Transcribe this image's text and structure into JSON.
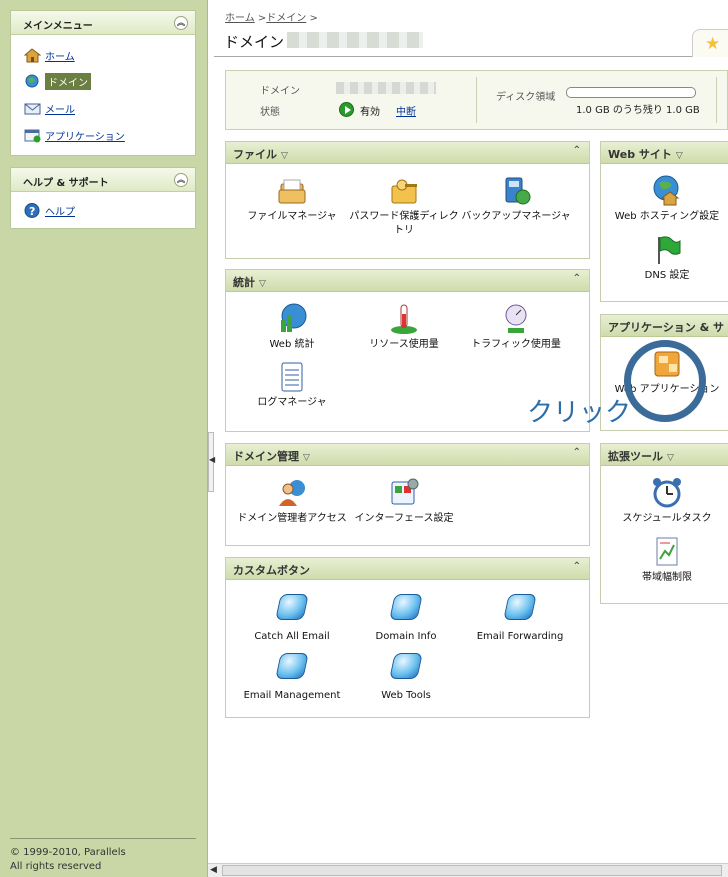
{
  "sidebar": {
    "main_menu": {
      "title": "メインメニュー",
      "items": [
        {
          "label": "ホーム",
          "icon": "home-icon"
        },
        {
          "label": "ドメイン",
          "icon": "domain-icon",
          "active": true
        },
        {
          "label": "メール",
          "icon": "mail-icon"
        },
        {
          "label": "アプリケーション",
          "icon": "application-icon"
        }
      ]
    },
    "help_menu": {
      "title": "ヘルプ & サポート",
      "items": [
        {
          "label": "ヘルプ",
          "icon": "help-icon"
        }
      ]
    },
    "copyright_line1": "© 1999-2010, Parallels",
    "copyright_line2": "All rights reserved"
  },
  "breadcrumb": {
    "home": "ホーム",
    "sep": ">",
    "domain": "ドメイン"
  },
  "page_title": "ドメイン",
  "info": {
    "domain_label": "ドメイン",
    "status_label": "状態",
    "status_value": "有効",
    "suspend_link": "中断",
    "disk_label": "ディスク領域",
    "disk_text": "1.0 GB のうち残り 1.0 GB",
    "disk_used_fraction": 0
  },
  "panels": {
    "files": {
      "title": "ファイル",
      "tools": [
        "ファイルマネージャ",
        "パスワード保護ディレクトリ",
        "バックアップマネージャ"
      ]
    },
    "stats": {
      "title": "統計",
      "tools": [
        "Web 統計",
        "リソース使用量",
        "トラフィック使用量",
        "ログマネージャ"
      ]
    },
    "domain_admin": {
      "title": "ドメイン管理",
      "tools": [
        "ドメイン管理者アクセス",
        "インターフェース設定"
      ]
    },
    "custom_buttons": {
      "title": "カスタムボタン",
      "tools": [
        "Catch All Email",
        "Domain Info",
        "Email Forwarding",
        "Email Management",
        "Web Tools"
      ]
    },
    "website": {
      "title": "Web サイト",
      "tools": [
        "Web ホスティング設定",
        "DNS 設定"
      ]
    },
    "apps": {
      "title": "アプリケーション & サ",
      "tools": [
        "Web アプリケーション"
      ]
    },
    "ext_tools": {
      "title": "拡張ツール",
      "tools": [
        "スケジュールタスク",
        "帯域幅制限"
      ]
    }
  },
  "annotation": {
    "text": "クリック",
    "color": "#2d6da8"
  },
  "colors": {
    "sidebar_bg": "#c9d7a6",
    "panel_header": "#cfdcab",
    "link": "#003399"
  }
}
